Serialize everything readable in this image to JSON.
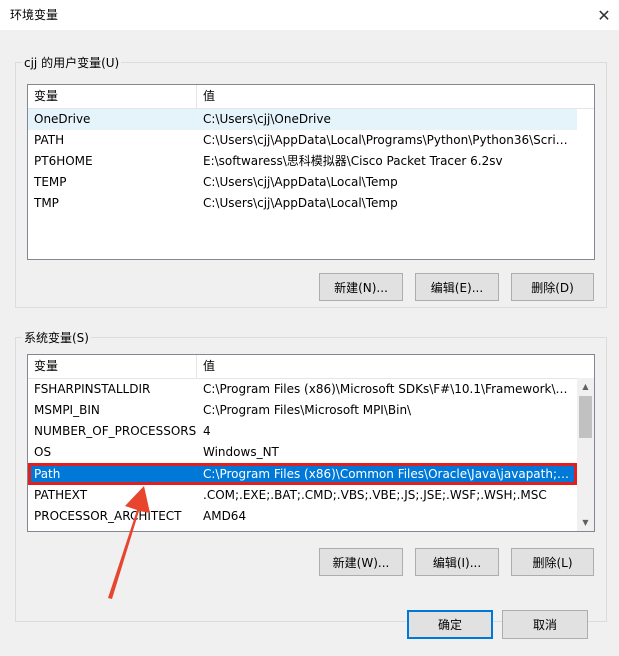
{
  "window": {
    "title": "环境变量",
    "close_glyph": "✕"
  },
  "user_vars": {
    "group_label": "cjj 的用户变量(U)",
    "columns": [
      "变量",
      "值"
    ],
    "rows": [
      {
        "name": "OneDrive",
        "value": "C:\\Users\\cjj\\OneDrive"
      },
      {
        "name": "PATH",
        "value": "C:\\Users\\cjj\\AppData\\Local\\Programs\\Python\\Python36\\Scrip..."
      },
      {
        "name": "PT6HOME",
        "value": "E:\\softwaress\\思科模拟器\\Cisco Packet Tracer 6.2sv"
      },
      {
        "name": "TEMP",
        "value": "C:\\Users\\cjj\\AppData\\Local\\Temp"
      },
      {
        "name": "TMP",
        "value": "C:\\Users\\cjj\\AppData\\Local\\Temp"
      }
    ],
    "buttons": {
      "new": "新建(N)...",
      "edit": "编辑(E)...",
      "delete": "删除(D)"
    }
  },
  "sys_vars": {
    "group_label": "系统变量(S)",
    "columns": [
      "变量",
      "值"
    ],
    "rows": [
      {
        "name": "FSHARPINSTALLDIR",
        "value": "C:\\Program Files (x86)\\Microsoft SDKs\\F#\\10.1\\Framework\\v..."
      },
      {
        "name": "MSMPI_BIN",
        "value": "C:\\Program Files\\Microsoft MPI\\Bin\\"
      },
      {
        "name": "NUMBER_OF_PROCESSORS",
        "value": "4"
      },
      {
        "name": "OS",
        "value": "Windows_NT"
      },
      {
        "name": "Path",
        "value": "C:\\Program Files (x86)\\Common Files\\Oracle\\Java\\javapath;C:..."
      },
      {
        "name": "PATHEXT",
        "value": ".COM;.EXE;.BAT;.CMD;.VBS;.VBE;.JS;.JSE;.WSF;.WSH;.MSC"
      },
      {
        "name": "PROCESSOR_ARCHITECT",
        "value": "AMD64"
      }
    ],
    "buttons": {
      "new": "新建(W)...",
      "edit": "编辑(I)...",
      "delete": "删除(L)"
    }
  },
  "footer": {
    "ok": "确定",
    "cancel": "取消"
  },
  "colors": {
    "selected": "#0078d7",
    "highlight_box": "#e02020",
    "arrow": "#e8452f"
  },
  "icons": {
    "close": "close-icon",
    "scroll_up": "chevron-up-icon",
    "scroll_down": "chevron-down-icon",
    "annotation": "red-arrow-annotation"
  }
}
